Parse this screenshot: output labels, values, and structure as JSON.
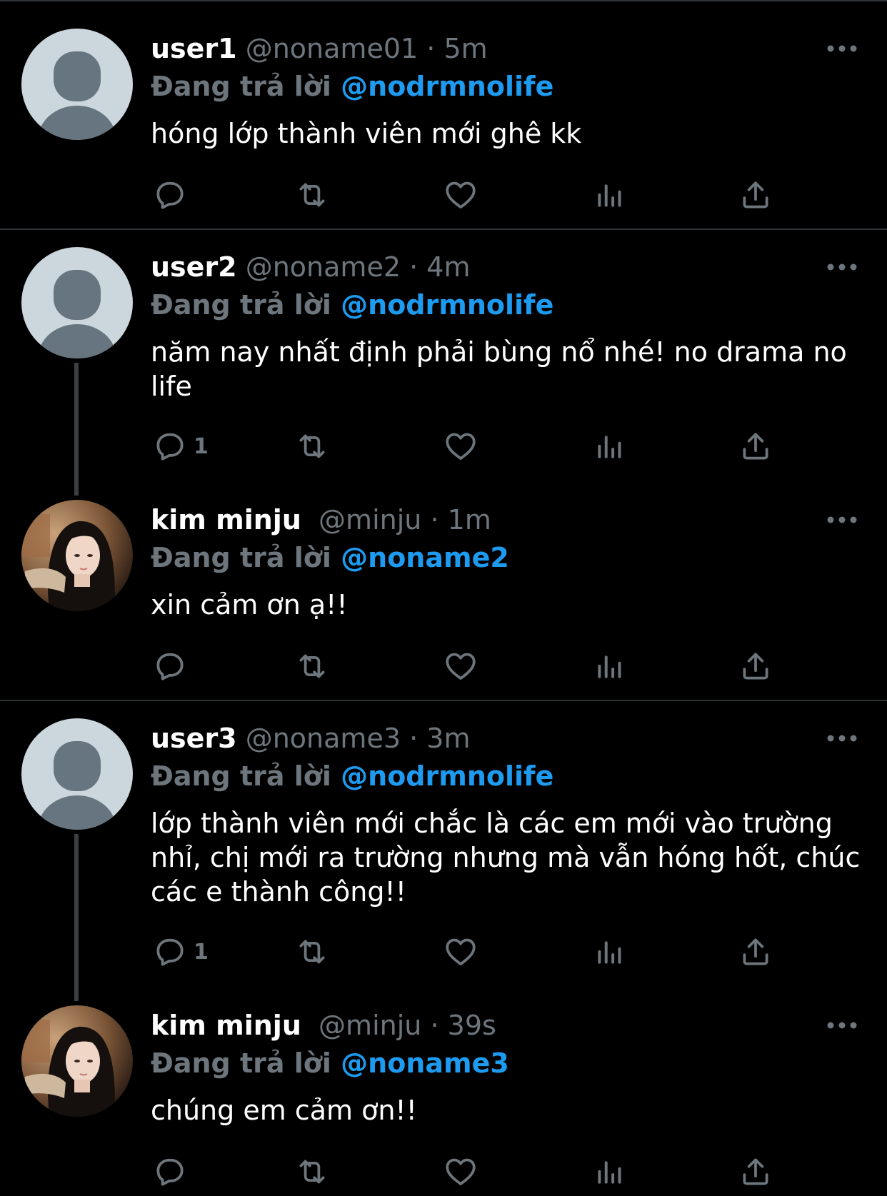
{
  "colors": {
    "background": "#000000",
    "mention": "#1d9bf0",
    "muted": "#6e767d",
    "text": "#ffffff"
  },
  "tweets": [
    {
      "name": "user1",
      "handle": "@noname01",
      "time": "5m",
      "replying_label": "Đang trả lời",
      "replying_to": "@nodrmnolife",
      "text": "hóng lớp thành viên mới ghê kk",
      "reply_count": "",
      "avatar": "default-avatar-icon"
    },
    {
      "name": "user2",
      "handle": "@noname2",
      "time": "4m",
      "replying_label": "Đang trả lời",
      "replying_to": "@nodrmnolife",
      "text": "năm nay nhất định phải bùng nổ nhé! no drama no life",
      "reply_count": "1",
      "avatar": "default-avatar-icon"
    },
    {
      "name": "kim minju",
      "handle": "@minju",
      "time": "1m",
      "replying_label": "Đang trả lời",
      "replying_to": "@noname2",
      "text": "xin cảm ơn ạ!!",
      "reply_count": "",
      "avatar": "profile-photo"
    },
    {
      "name": "user3",
      "handle": "@noname3",
      "time": "3m",
      "replying_label": "Đang trả lời",
      "replying_to": "@nodrmnolife",
      "text": "lớp thành viên mới chắc là các em mới vào trường nhỉ, chị mới ra trường nhưng mà vẫn hóng hốt, chúc các e thành công!!",
      "reply_count": "1",
      "avatar": "default-avatar-icon"
    },
    {
      "name": "kim minju",
      "handle": "@minju",
      "time": "39s",
      "replying_label": "Đang trả lời",
      "replying_to": "@noname3",
      "text": "chúng em cảm ơn!!",
      "reply_count": "",
      "avatar": "profile-photo"
    }
  ],
  "separator": "·",
  "action_icons": [
    "reply-icon",
    "retweet-icon",
    "like-icon",
    "analytics-icon",
    "share-icon"
  ]
}
